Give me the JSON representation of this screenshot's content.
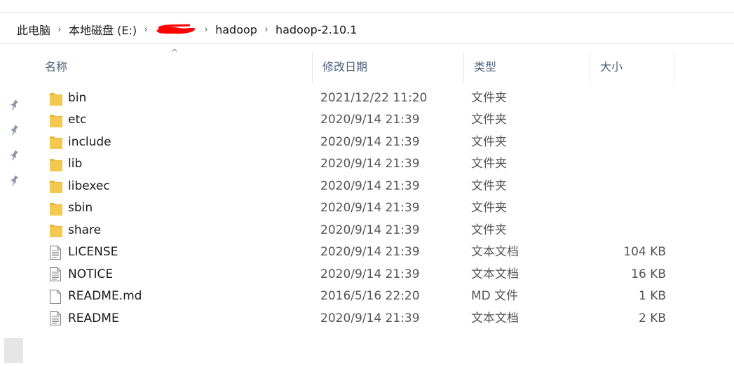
{
  "breadcrumb": [
    {
      "label": "此电脑"
    },
    {
      "label": "本地磁盘 (E:)"
    },
    {
      "label": ""
    },
    {
      "label": "hadoop"
    },
    {
      "label": "hadoop-2.10.1"
    }
  ],
  "columns": {
    "name": "名称",
    "modified": "修改日期",
    "type": "类型",
    "size": "大小"
  },
  "sort_indicator": "^",
  "files": [
    {
      "name": "bin",
      "modified": "2021/12/22 11:20",
      "type": "文件夹",
      "size": "",
      "icon": "folder-icon"
    },
    {
      "name": "etc",
      "modified": "2020/9/14 21:39",
      "type": "文件夹",
      "size": "",
      "icon": "folder-icon"
    },
    {
      "name": "include",
      "modified": "2020/9/14 21:39",
      "type": "文件夹",
      "size": "",
      "icon": "folder-icon"
    },
    {
      "name": "lib",
      "modified": "2020/9/14 21:39",
      "type": "文件夹",
      "size": "",
      "icon": "folder-icon"
    },
    {
      "name": "libexec",
      "modified": "2020/9/14 21:39",
      "type": "文件夹",
      "size": "",
      "icon": "folder-icon"
    },
    {
      "name": "sbin",
      "modified": "2020/9/14 21:39",
      "type": "文件夹",
      "size": "",
      "icon": "folder-icon"
    },
    {
      "name": "share",
      "modified": "2020/9/14 21:39",
      "type": "文件夹",
      "size": "",
      "icon": "folder-icon"
    },
    {
      "name": "LICENSE",
      "modified": "2020/9/14 21:39",
      "type": "文本文档",
      "size": "104 KB",
      "icon": "text-file-icon"
    },
    {
      "name": "NOTICE",
      "modified": "2020/9/14 21:39",
      "type": "文本文档",
      "size": "16 KB",
      "icon": "text-file-icon"
    },
    {
      "name": "README.md",
      "modified": "2016/5/16 22:20",
      "type": "MD 文件",
      "size": "1 KB",
      "icon": "blank-file-icon"
    },
    {
      "name": "README",
      "modified": "2020/9/14 21:39",
      "type": "文本文档",
      "size": "2 KB",
      "icon": "text-file-icon"
    }
  ],
  "quick_access_pins": [
    "pin-icon",
    "pin-icon",
    "pin-icon",
    "pin-icon"
  ],
  "colors": {
    "folder": "#f3c94f",
    "header_text": "#4c607a",
    "redaction": "#ff0000"
  }
}
